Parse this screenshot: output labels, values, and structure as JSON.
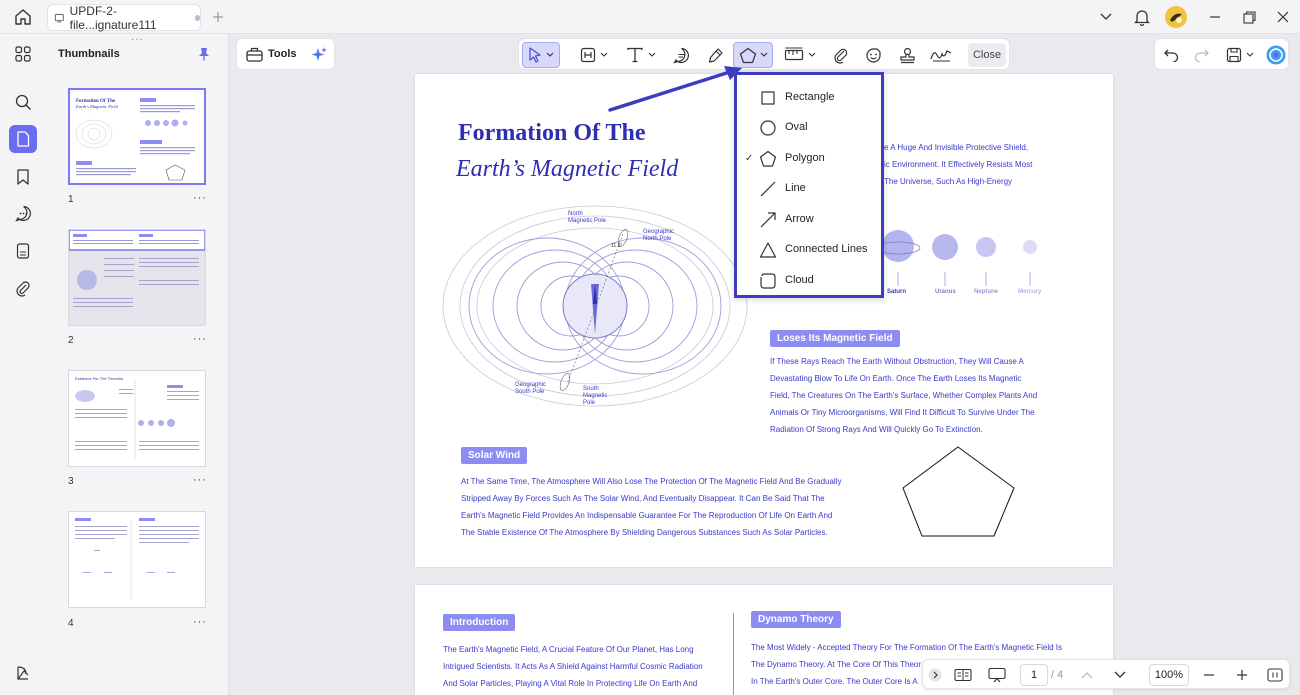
{
  "window": {
    "tab_title": "UPDF-2-file...ignature111",
    "new_tab_icon": "plus-icon"
  },
  "sidebar": {
    "title": "Thumbnails",
    "pages": [
      {
        "number": "1",
        "more": "···"
      },
      {
        "number": "2",
        "more": "···"
      },
      {
        "number": "3",
        "more": "···"
      },
      {
        "number": "4",
        "more": "···"
      }
    ]
  },
  "toolbar": {
    "tools_label": "Tools",
    "close_label": "Close"
  },
  "shape_menu": {
    "items": [
      {
        "label": "Rectangle",
        "checked": false
      },
      {
        "label": "Oval",
        "checked": false
      },
      {
        "label": "Polygon",
        "checked": true
      },
      {
        "label": "Line",
        "checked": false
      },
      {
        "label": "Arrow",
        "checked": false
      },
      {
        "label": "Connected Lines",
        "checked": false
      },
      {
        "label": "Cloud",
        "checked": false
      }
    ],
    "check_mark": "✓"
  },
  "document": {
    "page1": {
      "title_line1": "Formation Of The",
      "title_line2": "Earth’s Magnetic Field",
      "intro_partial": [
        "e A Huge And Invisible Protective Shield,",
        "ic Environment. It Effectively Resists Most",
        "The Universe, Such As High-Energy"
      ],
      "diagram_labels": {
        "north_magnetic": "North\nMagnetic Pole",
        "geo_north": "Geographic\nNorth Pole",
        "angle": "11.5°",
        "geo_south": "Geographic\nSouth Pole",
        "south_magnetic": "South\nMagnetic\nPole"
      },
      "planets": [
        "Saturn",
        "Uranus",
        "Neptune",
        "Mercury"
      ],
      "section_loses": {
        "heading": "Loses Its Magnetic Field",
        "lines": [
          "If These Rays Reach The Earth Without Obstruction, They Will Cause A",
          "Devastating Blow To Life On Earth. Once The Earth Loses Its Magnetic",
          "Field, The Creatures On The Earth's Surface, Whether Complex Plants And",
          "Animals Or Tiny Microorganisms, Will Find It Difficult To Survive Under The",
          "Radiation Of Strong Rays And Will Quickly Go To Extinction."
        ]
      },
      "section_solar": {
        "heading": "Solar Wind",
        "lines": [
          "At The Same Time, The Atmosphere Will Also Lose The Protection Of The Magnetic Field And Be Gradually",
          "Stripped Away By Forces Such As The Solar Wind, And Eventually Disappear. It Can Be Said That The",
          "Earth's Magnetic Field Provides An Indispensable Guarantee For The Reproduction Of Life On Earth And",
          "The Stable Existence Of The Atmosphere By Shielding Dangerous Substances Such As Solar Particles."
        ]
      }
    },
    "page2": {
      "intro_heading": "Introduction",
      "intro_lines": [
        "The Earth's Magnetic Field, A Crucial Feature Of Our Planet, Has Long",
        "Intrigued Scientists. It Acts As A Shield Against Harmful Cosmic Radiation",
        "And Solar Particles, Playing A Vital Role In Protecting Life On Earth And"
      ],
      "dynamo_heading": "Dynamo Theory",
      "dynamo_lines": [
        "The Most Widely - Accepted Theory For The Formation Of The Earth's Magnetic Field Is",
        "The Dynamo Theory. At The Core Of This Theor",
        "In The Earth's Outer Core. The Outer Core Is A"
      ]
    }
  },
  "bottombar": {
    "current_page": "1",
    "total_pages": "/ 4",
    "zoom": "100%"
  },
  "colors": {
    "accent": "#6c6cf0",
    "doc_text": "#3a3ac8",
    "menu_border": "#3d3dbd",
    "pill": "#8c8cf2",
    "title_blue": "#2e2eb0"
  }
}
